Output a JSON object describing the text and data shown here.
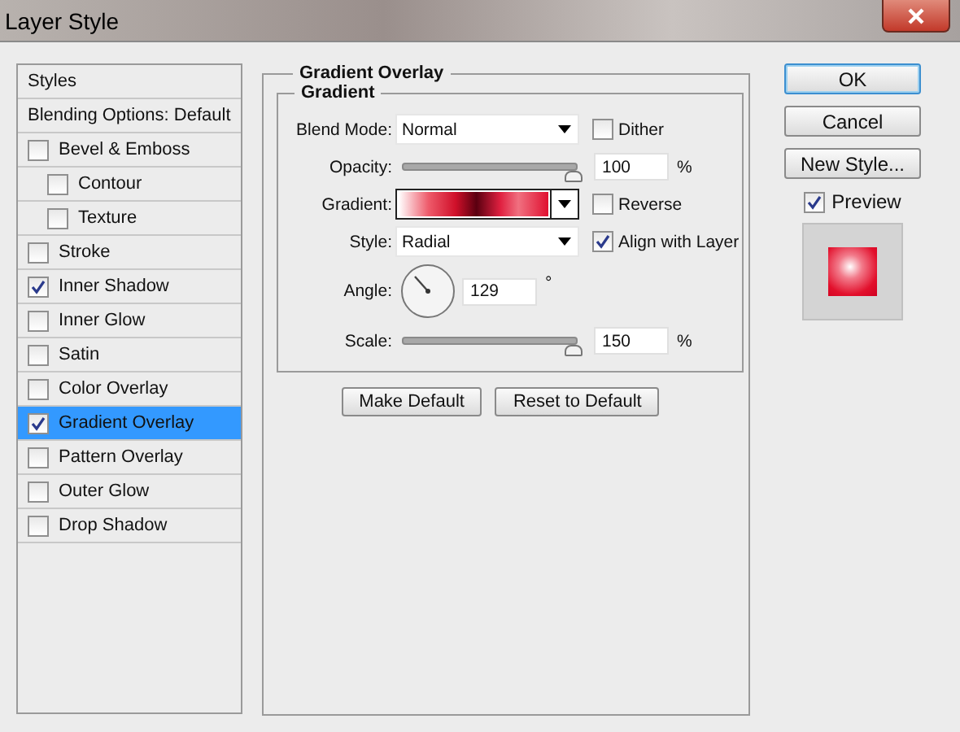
{
  "window": {
    "title": "Layer Style"
  },
  "sidebar": {
    "items": [
      {
        "kind": "header",
        "label": "Styles",
        "selected": false
      },
      {
        "kind": "header",
        "label": "Blending Options: Default",
        "selected": false
      },
      {
        "kind": "effect",
        "label": "Bevel & Emboss",
        "checked": false,
        "selected": false,
        "children": [
          {
            "kind": "effect",
            "label": "Contour",
            "checked": false,
            "selected": false
          },
          {
            "kind": "effect",
            "label": "Texture",
            "checked": false,
            "selected": false
          }
        ]
      },
      {
        "kind": "effect",
        "label": "Stroke",
        "checked": false,
        "selected": false
      },
      {
        "kind": "effect",
        "label": "Inner Shadow",
        "checked": true,
        "selected": false
      },
      {
        "kind": "effect",
        "label": "Inner Glow",
        "checked": false,
        "selected": false
      },
      {
        "kind": "effect",
        "label": "Satin",
        "checked": false,
        "selected": false
      },
      {
        "kind": "effect",
        "label": "Color Overlay",
        "checked": false,
        "selected": false
      },
      {
        "kind": "effect",
        "label": "Gradient Overlay",
        "checked": true,
        "selected": true
      },
      {
        "kind": "effect",
        "label": "Pattern Overlay",
        "checked": false,
        "selected": false
      },
      {
        "kind": "effect",
        "label": "Outer Glow",
        "checked": false,
        "selected": false
      },
      {
        "kind": "effect",
        "label": "Drop Shadow",
        "checked": false,
        "selected": false
      }
    ]
  },
  "panel": {
    "title": "Gradient Overlay",
    "group": {
      "title": "Gradient",
      "rows": [
        {
          "kind": "dropdown",
          "label": "Blend Mode:",
          "value": "Normal",
          "option": {
            "label": "Dither",
            "checked": false
          }
        },
        {
          "kind": "slider",
          "label": "Opacity:",
          "level": 0.98,
          "value": "100",
          "unit": "%"
        },
        {
          "kind": "gradient",
          "label": "Gradient:",
          "option": {
            "label": "Reverse",
            "checked": false
          }
        },
        {
          "kind": "dropdown",
          "label": "Style:",
          "value": "Radial",
          "option": {
            "label": "Align with Layer",
            "checked": true
          }
        },
        {
          "kind": "angle",
          "label": "Angle:",
          "value": "129",
          "unit": "°"
        },
        {
          "kind": "slider",
          "label": "Scale:",
          "level": 0.98,
          "value": "150",
          "unit": "%"
        }
      ]
    },
    "buttons": [
      "Make Default",
      "Reset to Default"
    ]
  },
  "actions": {
    "buttons": [
      {
        "label": "OK",
        "default": true
      },
      {
        "label": "Cancel",
        "default": false
      },
      {
        "label": "New Style...",
        "default": false
      }
    ],
    "preview": {
      "label": "Preview",
      "checked": true
    }
  }
}
